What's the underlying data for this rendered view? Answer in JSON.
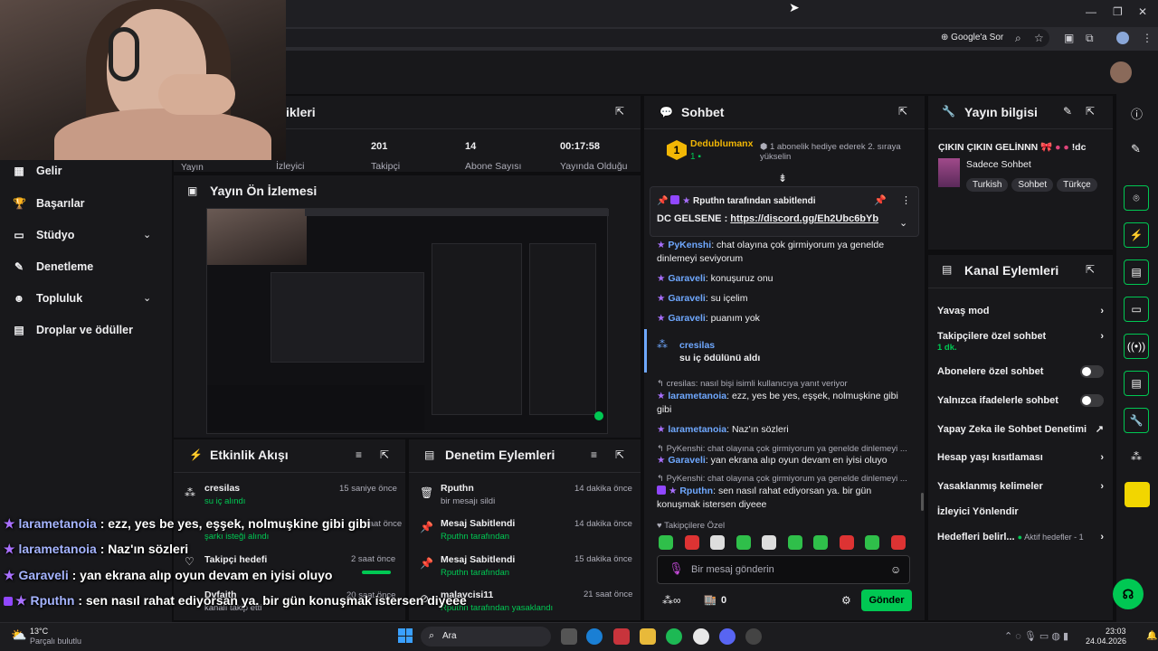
{
  "browser": {
    "google_label": "Google'a Sor"
  },
  "sidebar": {
    "items": [
      {
        "label": "Gelir",
        "icon": "dollar-icon"
      },
      {
        "label": "Başarılar",
        "icon": "trophy-icon"
      },
      {
        "label": "Stüdyo",
        "icon": "studio-icon"
      },
      {
        "label": "Denetleme",
        "icon": "wrench-icon"
      },
      {
        "label": "Topluluk",
        "icon": "community-icon"
      },
      {
        "label": "Droplar ve ödüller",
        "icon": "gift-icon"
      }
    ]
  },
  "stats": {
    "title": "ikleri",
    "items": [
      {
        "value": "201",
        "label": "Takipçi"
      },
      {
        "value": "14",
        "label": "Abone Sayısı"
      },
      {
        "value": "00:17:58",
        "label": "Yayında Olduğu"
      }
    ],
    "partial_labels": [
      "Yayın",
      "İzleyici"
    ]
  },
  "preview": {
    "title": "Yayın Ön İzlemesi"
  },
  "activity": {
    "title": "Etkinlik Akışı",
    "items": [
      {
        "user": "cresilas",
        "detail": "su iç alındı",
        "time": "15 saniye önce"
      },
      {
        "user": "",
        "detail": "şarkı isteği alındı",
        "time": "saat önce"
      },
      {
        "user": "Takipçi hedefi",
        "detail": "",
        "time": "2 saat önce"
      },
      {
        "user": "Dvfaith",
        "detail": "kanalı takip etti",
        "time": "20 saat önce"
      }
    ]
  },
  "moderation": {
    "title": "Denetim Eylemleri",
    "items": [
      {
        "title": "Rputhn",
        "detail": "bir mesajı sildi",
        "time": "14 dakika önce",
        "icon": "trash-icon"
      },
      {
        "title": "Mesaj Sabitlendi",
        "detail": "Rputhn tarafından",
        "time": "14 dakika önce",
        "icon": "pin-icon"
      },
      {
        "title": "Mesaj Sabitlendi",
        "detail": "Rputhn tarafından",
        "time": "15 dakika önce",
        "icon": "pin-icon"
      },
      {
        "title": "malaycisi11",
        "detail": "Rputhn tarafından yasaklandı",
        "time": "21 saat önce",
        "icon": "ban-icon"
      }
    ]
  },
  "chat": {
    "title": "Sohbet",
    "top_gifter": {
      "name": "Dedublumanx",
      "count": "1",
      "rank": "1"
    },
    "promo": "1 abonelik hediye ederek 2. sıraya yükselin",
    "pinned": {
      "by": "Rputhn tarafından sabitlendi",
      "text": "DC GELSENE : ",
      "link": "https://discord.gg/Eh2Ubc6bYb"
    },
    "messages": [
      {
        "user": "PyKenshi",
        "text": "chat olayına çok girmiyorum ya genelde dinlemeyi seviyorum"
      },
      {
        "user": "Garaveli",
        "text": "konuşuruz onu"
      },
      {
        "user": "Garaveli",
        "text": "su içelim"
      },
      {
        "user": "Garaveli",
        "text": "puanım yok"
      }
    ],
    "redemption": {
      "user": "cresilas",
      "text": "su iç ödülünü aldı"
    },
    "messages2": [
      {
        "reply": "cresilas: nasıl bişi isimli kullanıcıya yanıt veriyor",
        "user": "larametanoia",
        "text": "ezz, yes be yes, eşşek, nolmuşkine gibi gibi"
      },
      {
        "reply": "",
        "user": "larametanoia",
        "text": "Naz'ın sözleri"
      },
      {
        "reply": "PyKenshi: chat olayına çok girmiyorum ya genelde dinlemeyi ...",
        "user": "Garaveli",
        "text": "yan ekrana alıp oyun devam en iyisi oluyo"
      },
      {
        "reply": "PyKenshi: chat olayına çok girmiyorum ya genelde dinlemeyi ...",
        "user": "Rputhn",
        "text": "sen nasıl rahat ediyorsan ya. bir gün konuşmak istersen diyeee"
      }
    ],
    "followers_only": "Takipçilere Özel",
    "input_placeholder": "Bir mesaj gönderin",
    "points": "0",
    "send_label": "Gönder"
  },
  "stream_info": {
    "title": "Yayın bilgisi",
    "stream_title": "ÇIKIN ÇIKIN GELİNNN",
    "stream_title_suffix": "!dc",
    "category": "Sadece Sohbet",
    "tags": [
      "Turkish",
      "Sohbet",
      "Türkçe"
    ]
  },
  "channel_actions": {
    "title": "Kanal Eylemleri",
    "rows": [
      {
        "label": "Yavaş mod",
        "sub": "",
        "control": "chevron"
      },
      {
        "label": "Takipçilere özel sohbet",
        "sub": "1 dk.",
        "control": "chevron"
      },
      {
        "label": "Abonelere özel sohbet",
        "sub": "",
        "control": "toggle"
      },
      {
        "label": "Yalnızca ifadelerle sohbet",
        "sub": "",
        "control": "toggle"
      },
      {
        "label": "Yapay Zeka ile Sohbet Denetimi",
        "sub": "",
        "control": "external"
      },
      {
        "label": "Hesap yaşı kısıtlaması",
        "sub": "",
        "control": "chevron"
      },
      {
        "label": "Yasaklanmış kelimeler",
        "sub": "",
        "control": "chevron"
      },
      {
        "label": "İzleyici Yönlendir",
        "sub": "",
        "control": "none"
      },
      {
        "label": "Hedefleri belirl...",
        "sub": "Aktif hedefler - 1",
        "control": "chevron"
      }
    ]
  },
  "overlay": [
    {
      "user": "larametanoia",
      "text": " : ezz, yes be yes, eşşek, nolmuşkine gibi gibi"
    },
    {
      "user": "larametanoia",
      "text": " : Naz'ın sözleri"
    },
    {
      "user": "Garaveli",
      "text": " : yan ekrana alıp oyun devam en iyisi oluyo"
    },
    {
      "user": "Rputhn",
      "text": " : sen nasıl rahat ediyorsan ya. bir gün konuşmak istersen diyeee"
    }
  ],
  "taskbar": {
    "weather_temp": "13°C",
    "weather_desc": "Parçalı bulutlu",
    "search": "Ara",
    "time": "23:03",
    "date": "24.04.2026"
  },
  "colors": {
    "accent_green": "#00c853",
    "twitch_purple": "#9147ff"
  }
}
